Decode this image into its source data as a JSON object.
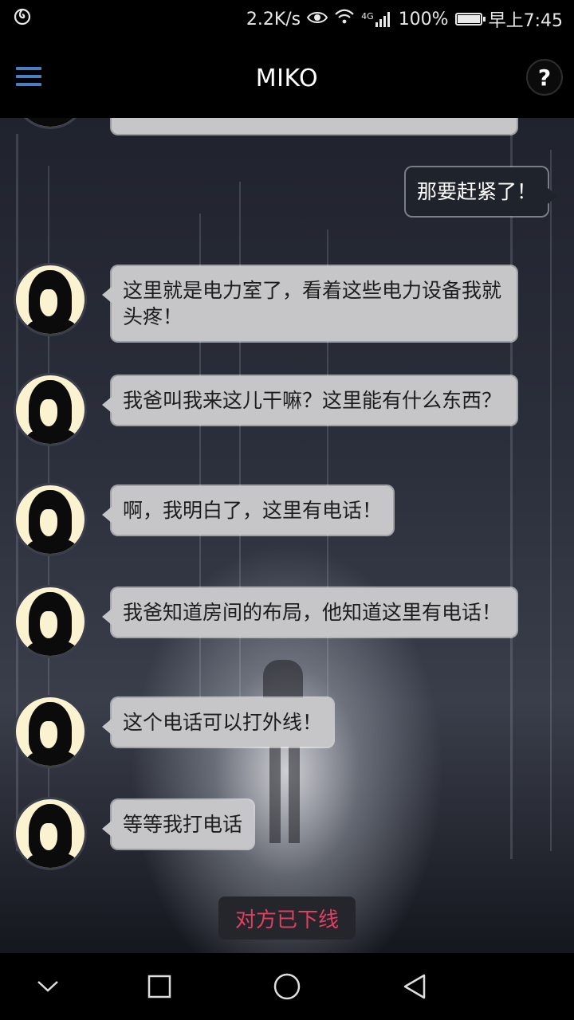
{
  "status_bar": {
    "speed": "2.2K/s",
    "network": "4G",
    "battery": "100%",
    "battery_level": 1.0,
    "time": "早上7:45"
  },
  "app_bar": {
    "title": "MIKO",
    "help_label": "?"
  },
  "messages": [
    {
      "from": "other",
      "text": ""
    },
    {
      "from": "me",
      "text": "那要赶紧了！"
    },
    {
      "from": "other",
      "text": "这里就是电力室了，看着这些电力设备我就头疼！"
    },
    {
      "from": "other",
      "text": "我爸叫我来这儿干嘛？这里能有什么东西？"
    },
    {
      "from": "other",
      "text": "啊，我明白了，这里有电话！"
    },
    {
      "from": "other",
      "text": "我爸知道房间的布局，他知道这里有电话！"
    },
    {
      "from": "other",
      "text": "这个电话可以打外线！"
    },
    {
      "from": "other",
      "text": "等等我打电话"
    }
  ],
  "offline_notice": "对方已下线",
  "colors": {
    "menu_icon": "#4a7fc4",
    "offline_text": "#e0405f",
    "other_bubble": "#c6c6c8",
    "my_bubble": "#1f232c"
  }
}
